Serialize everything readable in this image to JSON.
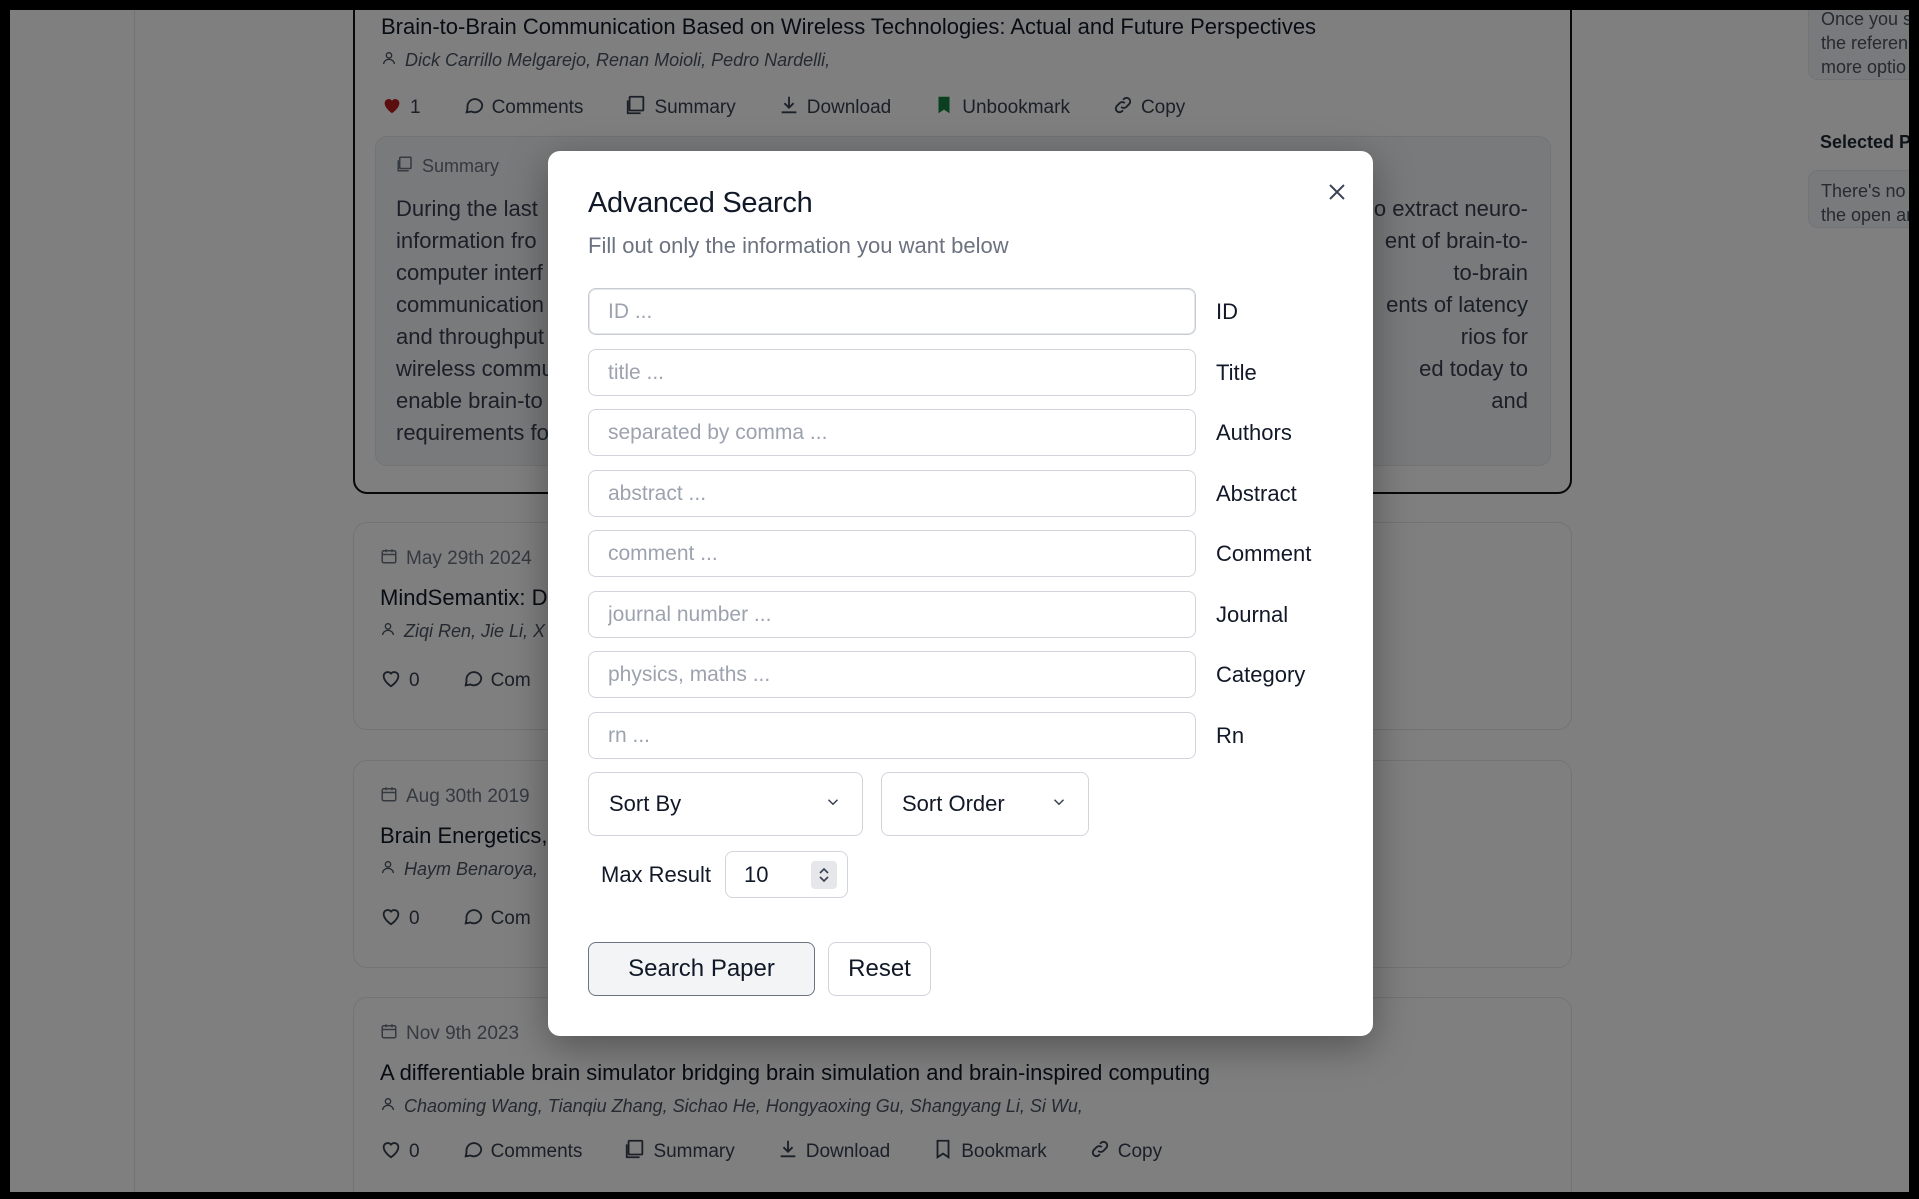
{
  "background": {
    "papers": [
      {
        "title": "Brain-to-Brain Communication Based on Wireless Technologies: Actual and Future Perspectives",
        "authors": "Dick Carrillo Melgarejo, Renan Moioli, Pedro Nardelli,",
        "actions": {
          "like_count": "1",
          "comments": "Comments",
          "summary": "Summary",
          "download": "Download",
          "bookmark": "Unbookmark",
          "copy": "Copy"
        },
        "summary_label": "Summary",
        "summary_left": [
          "During the last",
          "information fro",
          "computer interf",
          "communication",
          "and throughput",
          "wireless commu",
          "enable brain-to",
          "requirements fo"
        ],
        "summary_right": [
          "o extract neuro-",
          "ent of brain-to-",
          "to-brain",
          "ents of latency",
          "rios for",
          "ed today to",
          "and",
          ""
        ]
      },
      {
        "date": "May 29th 2024",
        "title": "MindSemantix: D",
        "authors": "Ziqi Ren, Jie Li, X",
        "actions": {
          "like_count": "0",
          "comments": "Com"
        }
      },
      {
        "date": "Aug 30th 2019",
        "title": "Brain Energetics,",
        "authors": "Haym Benaroya,",
        "actions": {
          "like_count": "0",
          "comments": "Com"
        }
      },
      {
        "date": "Nov 9th 2023",
        "title": "A differentiable brain simulator bridging brain simulation and brain-inspired computing",
        "authors": "Chaoming Wang, Tianqiu Zhang, Sichao He, Hongyaoxing Gu, Shangyang Li, Si Wu,",
        "actions": {
          "like_count": "0",
          "comments": "Comments",
          "summary": "Summary",
          "download": "Download",
          "bookmark": "Bookmark",
          "copy": "Copy"
        }
      }
    ],
    "right_rail": {
      "info_lines": [
        "Once you s",
        "the referen",
        "more optio"
      ],
      "selected_heading": "Selected Pa",
      "selected_lines": [
        "There's no s",
        "the open ar"
      ]
    }
  },
  "modal": {
    "title": "Advanced Search",
    "subtitle": "Fill out only the information you want below",
    "fields": [
      {
        "label": "ID",
        "placeholder": "ID ...",
        "value": ""
      },
      {
        "label": "Title",
        "placeholder": "title ...",
        "value": ""
      },
      {
        "label": "Authors",
        "placeholder": "separated by comma ...",
        "value": ""
      },
      {
        "label": "Abstract",
        "placeholder": "abstract ...",
        "value": ""
      },
      {
        "label": "Comment",
        "placeholder": "comment ...",
        "value": ""
      },
      {
        "label": "Journal",
        "placeholder": "journal number ...",
        "value": ""
      },
      {
        "label": "Category",
        "placeholder": "physics, maths ...",
        "value": ""
      },
      {
        "label": "Rn",
        "placeholder": "rn ...",
        "value": ""
      }
    ],
    "sort_by": "Sort By",
    "sort_order": "Sort Order",
    "max_result_label": "Max Result",
    "max_result_value": "10",
    "search_button": "Search Paper",
    "reset_button": "Reset"
  },
  "colors": {
    "like_filled": "#b91c1c",
    "bookmark_filled": "#15803d",
    "overlay": "rgba(0,0,0,0.5)"
  }
}
